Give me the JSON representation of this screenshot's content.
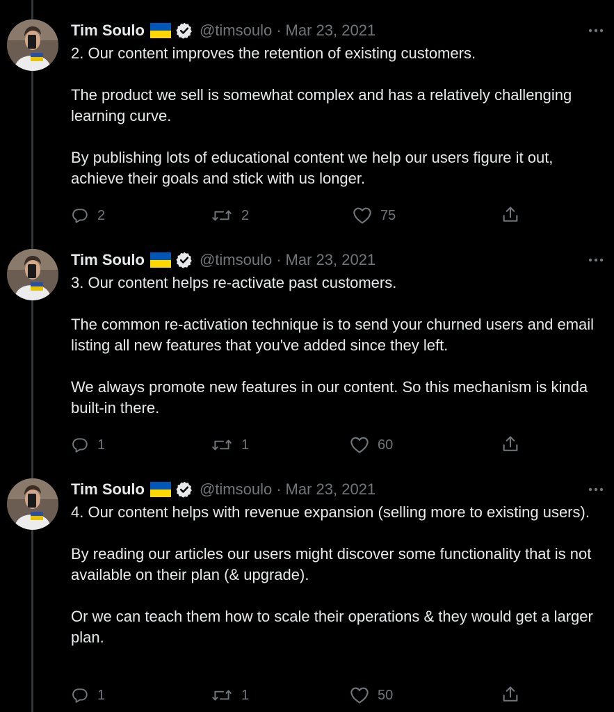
{
  "colors": {
    "background": "#000000",
    "text": "#e7e9ea",
    "muted": "#71767b",
    "verified_badge": "#e7e9ea",
    "flag_top": "#0057b7",
    "flag_bottom": "#ffd700",
    "thread_line": "#333639"
  },
  "icons": {
    "reply": "reply-icon",
    "retweet": "retweet-icon",
    "like": "heart-icon",
    "share": "share-icon",
    "more": "more-icon",
    "verified": "verified-badge-icon",
    "flag": "ukraine-flag-icon"
  },
  "tweets": [
    {
      "author": {
        "name": "Tim Soulo",
        "handle": "@timsoulo"
      },
      "separator": "·",
      "date": "Mar 23, 2021",
      "paragraphs": [
        "2. Our content improves the retention of existing customers.",
        "The product we sell is somewhat complex and has a relatively challenging learning curve.",
        "By publishing lots of educational content we help our users figure it out, achieve their goals and stick with us longer."
      ],
      "stats": {
        "replies": "2",
        "retweets": "2",
        "likes": "75"
      }
    },
    {
      "author": {
        "name": "Tim Soulo",
        "handle": "@timsoulo"
      },
      "separator": "·",
      "date": "Mar 23, 2021",
      "paragraphs": [
        "3. Our content helps re-activate past customers.",
        "The common re-activation technique is to send your churned users and email listing all new features that you've added since they left.",
        "We always promote new features in our content. So this mechanism is kinda built-in there."
      ],
      "stats": {
        "replies": "1",
        "retweets": "1",
        "likes": "60"
      }
    },
    {
      "author": {
        "name": "Tim Soulo",
        "handle": "@timsoulo"
      },
      "separator": "·",
      "date": "Mar 23, 2021",
      "paragraphs": [
        "4. Our content helps with revenue expansion (selling more to existing users).",
        "By reading our articles our users might discover some functionality that is not available on their plan (& upgrade).",
        "Or we can teach them how to scale their operations & they would get a larger plan."
      ],
      "stats": {
        "replies": "1",
        "retweets": "1",
        "likes": "50"
      }
    }
  ]
}
